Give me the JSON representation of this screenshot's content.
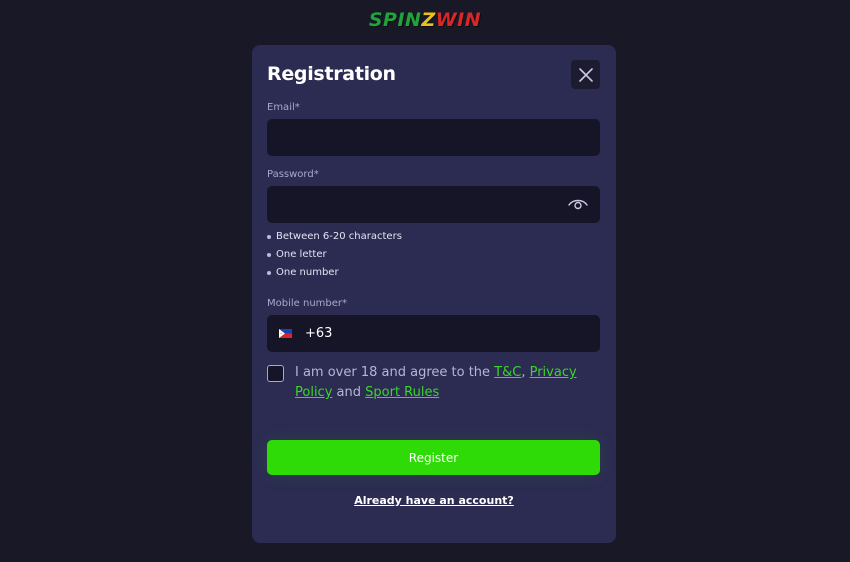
{
  "logo": {
    "part1": "SPIN",
    "part2": "Z",
    "part3": "WIN"
  },
  "modal": {
    "title": "Registration",
    "close_icon": "close-icon"
  },
  "form": {
    "email": {
      "label": "Email*",
      "value": "",
      "placeholder": ""
    },
    "password": {
      "label": "Password*",
      "value": "",
      "placeholder": "",
      "toggle_icon": "eye-icon",
      "rules": [
        "Between 6-20 characters",
        "One letter",
        "One number"
      ]
    },
    "mobile": {
      "label": "Mobile number*",
      "flag_icon": "philippines-flag-icon",
      "country_code": "+63"
    },
    "agree": {
      "text_before": "I am over 18 and agree to the ",
      "tc_link": "T&C",
      "comma": ", ",
      "privacy_link": "Privacy Policy",
      "and_text": " and ",
      "sport_link": "Sport Rules",
      "checked": false
    },
    "register_label": "Register",
    "login_link": "Already have an account?"
  },
  "colors": {
    "background": "#181827",
    "modal": "#2c2b52",
    "input": "#161527",
    "accent_green": "#2fdb07",
    "link_green": "#3ad62a"
  }
}
